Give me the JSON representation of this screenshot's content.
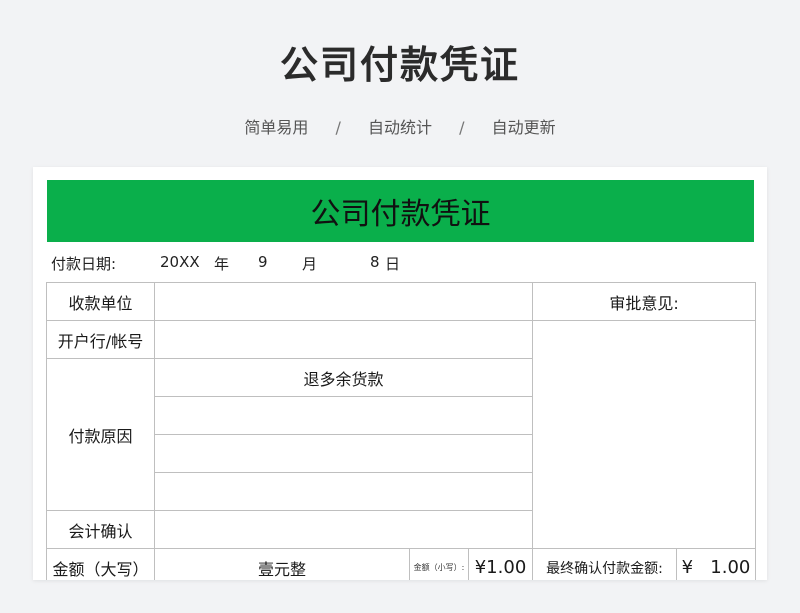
{
  "header": {
    "title": "公司付款凭证",
    "tags": [
      "简单易用",
      "自动统计",
      "自动更新"
    ],
    "separator": "/"
  },
  "voucher": {
    "banner_title": "公司付款凭证",
    "date": {
      "label": "付款日期:",
      "year": "20XX",
      "year_unit": "年",
      "month": "9",
      "month_unit": "月",
      "day": "8",
      "day_unit": "日"
    },
    "rows": {
      "payee_label": "收款单位",
      "payee_value": "",
      "bank_label": "开户行/帐号",
      "bank_value": "",
      "reason_label": "付款原因",
      "reason_lines": [
        "退多余货款",
        "",
        "",
        ""
      ],
      "accounting_label": "会计确认",
      "accounting_value": "",
      "amount_upper_label": "金额（大写）",
      "amount_upper_value": "壹元整",
      "amount_lower_label": "金额（小写）:",
      "amount_lower_value": "¥1.00",
      "final_amount_label": "最终确认付款金额:",
      "final_amount_value": "¥   1.00"
    },
    "approval": {
      "label": "审批意见:",
      "value": ""
    }
  }
}
